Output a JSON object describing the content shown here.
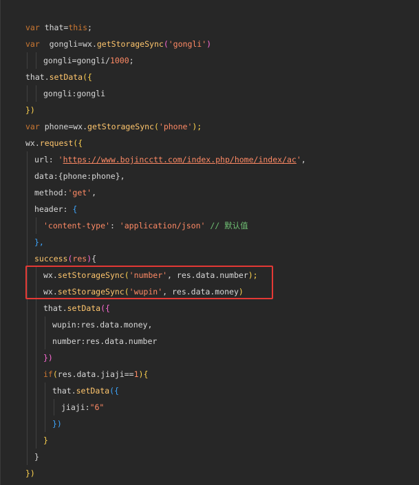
{
  "lines": [
    {
      "indent": 0,
      "tokens": [
        {
          "t": "var",
          "c": "kw"
        },
        {
          "t": " that=",
          "c": "pn"
        },
        {
          "t": "this",
          "c": "kw"
        },
        {
          "t": ";",
          "c": "pn"
        }
      ]
    },
    {
      "indent": 0,
      "tokens": [
        {
          "t": "var",
          "c": "kw"
        },
        {
          "t": "  gongli=wx.",
          "c": "pn"
        },
        {
          "t": "getStorageSync",
          "c": "fn"
        },
        {
          "t": "(",
          "c": "brace-m"
        },
        {
          "t": "'gongli'",
          "c": "str"
        },
        {
          "t": ")",
          "c": "brace-m"
        }
      ]
    },
    {
      "indent": 1,
      "tokens": [
        {
          "t": "gongli=gongli/",
          "c": "pn"
        },
        {
          "t": "1000",
          "c": "num"
        },
        {
          "t": ";",
          "c": "pn"
        }
      ]
    },
    {
      "indent": 0,
      "tokens": [
        {
          "t": "that.",
          "c": "pn"
        },
        {
          "t": "setData",
          "c": "fn"
        },
        {
          "t": "({",
          "c": "brace-y"
        }
      ]
    },
    {
      "indent": 1,
      "tokens": [
        {
          "t": "gongli:gongli",
          "c": "pn"
        }
      ]
    },
    {
      "indent": 0,
      "tokens": [
        {
          "t": "})",
          "c": "brace-y"
        }
      ]
    },
    {
      "indent": 0,
      "tokens": [
        {
          "t": "var",
          "c": "kw"
        },
        {
          "t": " phone=wx.",
          "c": "pn"
        },
        {
          "t": "getStorageSync",
          "c": "fn"
        },
        {
          "t": "(",
          "c": "brace-y"
        },
        {
          "t": "'phone'",
          "c": "str"
        },
        {
          "t": ");",
          "c": "brace-y"
        }
      ]
    },
    {
      "indent": 0,
      "tokens": [
        {
          "t": "wx.",
          "c": "pn"
        },
        {
          "t": "request",
          "c": "fn"
        },
        {
          "t": "({",
          "c": "brace-y"
        }
      ]
    },
    {
      "indent": 0.5,
      "tokens": [
        {
          "t": "url",
          "c": "pn"
        },
        {
          "t": ": ",
          "c": "pn"
        },
        {
          "t": "'",
          "c": "str"
        },
        {
          "t": "https://www.bojincctt.com/index.php/home/index/ac",
          "c": "url"
        },
        {
          "t": "'",
          "c": "str"
        },
        {
          "t": ",",
          "c": "pn"
        }
      ]
    },
    {
      "indent": 0.5,
      "tokens": [
        {
          "t": "data",
          "c": "pn"
        },
        {
          "t": ":{",
          "c": "pn"
        },
        {
          "t": "phone:phone",
          "c": "pn"
        },
        {
          "t": "},",
          "c": "pn"
        }
      ]
    },
    {
      "indent": 0.5,
      "tokens": [
        {
          "t": "method",
          "c": "pn"
        },
        {
          "t": ":",
          "c": "pn"
        },
        {
          "t": "'get'",
          "c": "str"
        },
        {
          "t": ",",
          "c": "pn"
        }
      ]
    },
    {
      "indent": 0.5,
      "tokens": [
        {
          "t": "header",
          "c": "pn"
        },
        {
          "t": ": ",
          "c": "pn"
        },
        {
          "t": "{",
          "c": "brace-b"
        }
      ]
    },
    {
      "indent": 1,
      "tokens": [
        {
          "t": "'content-type'",
          "c": "str"
        },
        {
          "t": ": ",
          "c": "pn"
        },
        {
          "t": "'application/json'",
          "c": "str"
        },
        {
          "t": " // 默认值",
          "c": "cm"
        }
      ]
    },
    {
      "indent": 0.5,
      "tokens": [
        {
          "t": "},",
          "c": "brace-b"
        }
      ]
    },
    {
      "indent": 0.5,
      "tokens": [
        {
          "t": "success",
          "c": "fn"
        },
        {
          "t": "(",
          "c": "brace-m"
        },
        {
          "t": "res",
          "c": "str"
        },
        {
          "t": ")",
          "c": "brace-m"
        },
        {
          "t": "{",
          "c": "pn"
        }
      ]
    },
    {
      "indent": 1,
      "tokens": [
        {
          "t": "wx.",
          "c": "pn"
        },
        {
          "t": "setStorageSync",
          "c": "fn"
        },
        {
          "t": "(",
          "c": "brace-y"
        },
        {
          "t": "'number'",
          "c": "str"
        },
        {
          "t": ", res.data.number",
          "c": "pn"
        },
        {
          "t": ");",
          "c": "brace-y"
        }
      ]
    },
    {
      "indent": 1,
      "tokens": [
        {
          "t": "wx.",
          "c": "pn"
        },
        {
          "t": "setStorageSync",
          "c": "fn"
        },
        {
          "t": "(",
          "c": "brace-y"
        },
        {
          "t": "'wupin'",
          "c": "str"
        },
        {
          "t": ", res.data.money",
          "c": "pn"
        },
        {
          "t": ")",
          "c": "brace-y"
        }
      ]
    },
    {
      "indent": 1,
      "tokens": [
        {
          "t": "that.",
          "c": "pn"
        },
        {
          "t": "setData",
          "c": "fn"
        },
        {
          "t": "({",
          "c": "brace-m"
        }
      ]
    },
    {
      "indent": 1.5,
      "tokens": [
        {
          "t": "wupin:res.data.money,",
          "c": "pn"
        }
      ]
    },
    {
      "indent": 1.5,
      "tokens": [
        {
          "t": "number:res.data.number",
          "c": "pn"
        }
      ]
    },
    {
      "indent": 1,
      "tokens": [
        {
          "t": "})",
          "c": "brace-m"
        }
      ]
    },
    {
      "indent": 1,
      "tokens": [
        {
          "t": "if",
          "c": "kw"
        },
        {
          "t": "(",
          "c": "brace-y"
        },
        {
          "t": "res.data.jiaji==",
          "c": "pn"
        },
        {
          "t": "1",
          "c": "num"
        },
        {
          "t": "){",
          "c": "brace-y"
        }
      ]
    },
    {
      "indent": 1.5,
      "tokens": [
        {
          "t": "that.",
          "c": "pn"
        },
        {
          "t": "setData",
          "c": "fn"
        },
        {
          "t": "({",
          "c": "brace-b"
        }
      ]
    },
    {
      "indent": 2,
      "tokens": [
        {
          "t": "jiaji",
          "c": "pn"
        },
        {
          "t": ":",
          "c": "pn"
        },
        {
          "t": "\"6\"",
          "c": "str"
        }
      ]
    },
    {
      "indent": 1.5,
      "tokens": [
        {
          "t": "})",
          "c": "brace-b"
        }
      ]
    },
    {
      "indent": 1,
      "tokens": [
        {
          "t": "}",
          "c": "brace-y"
        }
      ]
    },
    {
      "indent": 0.5,
      "tokens": [
        {
          "t": "}",
          "c": "pn"
        }
      ]
    },
    {
      "indent": 0,
      "tokens": [
        {
          "t": "})",
          "c": "brace-y"
        }
      ]
    }
  ],
  "highlight": {
    "color": "#e53935"
  }
}
